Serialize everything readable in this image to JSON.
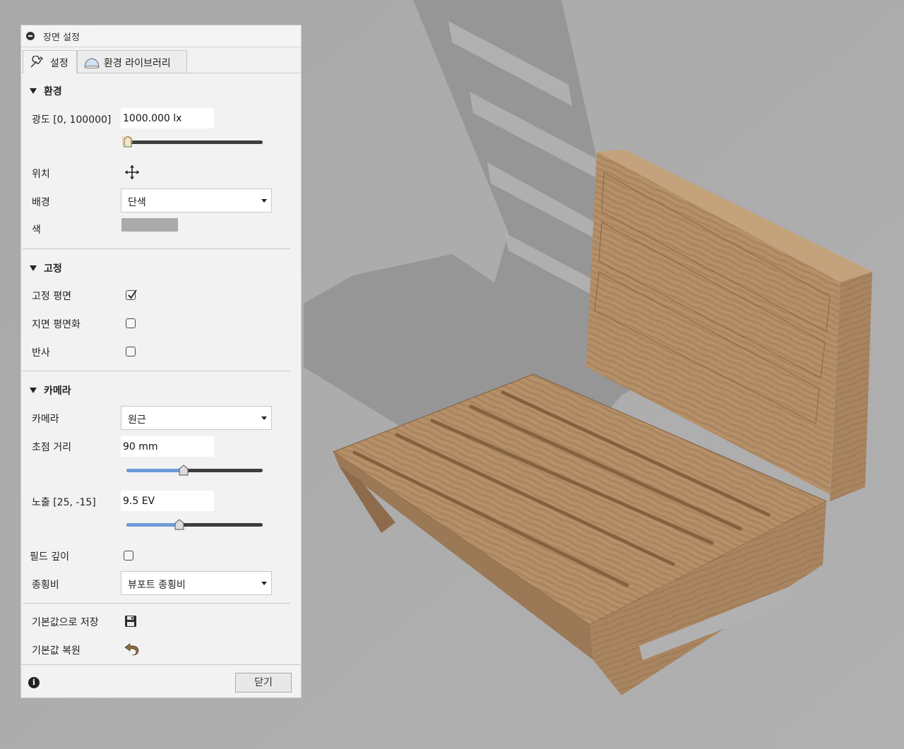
{
  "panel": {
    "title": "장면 설정",
    "tabs": [
      {
        "label": "설정",
        "icon": "wrench-icon",
        "active": true
      },
      {
        "label": "환경 라이브러리",
        "icon": "environment-dome-icon",
        "active": false
      }
    ],
    "close_label": "닫기",
    "info_icon": "info-icon"
  },
  "environment": {
    "header": "환경",
    "brightness": {
      "label": "광도 [0, 100000]",
      "value": "1000.000 lx",
      "level": 0.01
    },
    "position": {
      "label": "위치",
      "icon": "move-arrows-icon"
    },
    "background": {
      "label": "배경",
      "selected": "단색"
    },
    "color": {
      "label": "색",
      "value": "#aaaaaa"
    }
  },
  "ground": {
    "header": "고정",
    "ground_plane": {
      "label": "고정 평면",
      "checked": true
    },
    "flatten_ground": {
      "label": "지면 평면화",
      "checked": false
    },
    "reflections": {
      "label": "반사",
      "checked": false
    }
  },
  "camera": {
    "header": "카메라",
    "camera": {
      "label": "카메라",
      "selected": "원근"
    },
    "focal_length": {
      "label": "초점 거리",
      "value": "90 mm",
      "level": 0.42
    },
    "exposure": {
      "label": "노출 [25, -15]",
      "value": "9.5 EV",
      "level": 0.39
    },
    "depth_of_field": {
      "label": "필드 깊이",
      "checked": false
    },
    "aspect_ratio": {
      "label": "종횡비",
      "selected": "뷰포트 종횡비"
    }
  },
  "actions": {
    "save_default": {
      "label": "기본값으로 저장",
      "icon": "save-icon"
    },
    "restore_default": {
      "label": "기본값 복원",
      "icon": "undo-icon"
    }
  },
  "colors": {
    "viewport_background": "#acacac",
    "slider_fill": "#6e9ad8",
    "wood": "#b08b63"
  }
}
